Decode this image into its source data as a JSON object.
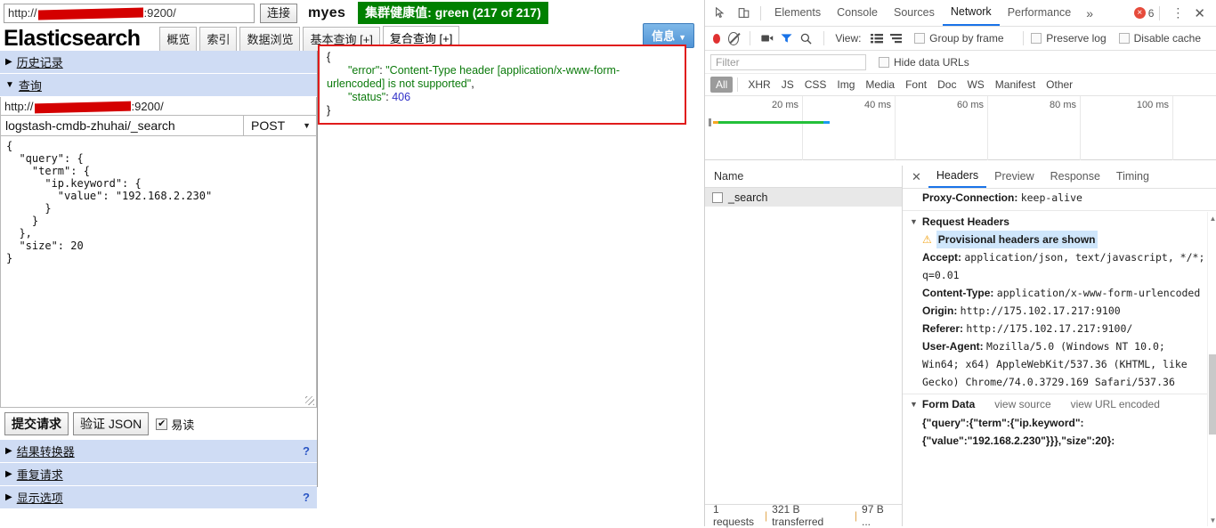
{
  "app": {
    "connect_url_prefix": "http://",
    "connect_url_suffix": ":9200/",
    "connect_button": "连接",
    "cluster_name": "myes",
    "health_badge": "集群健康值: green (217 of 217)",
    "brand": "Elasticsearch",
    "tabs": [
      {
        "label": "概览",
        "active": false
      },
      {
        "label": "索引",
        "active": false
      },
      {
        "label": "数据浏览",
        "active": false
      },
      {
        "label": "基本查询 [+]",
        "active": false
      },
      {
        "label": "复合查询 [+]",
        "active": true
      }
    ],
    "info_button": "信息",
    "sections": {
      "history": "历史记录",
      "query": "查询",
      "result_transformer": "结果转换器",
      "repeat_request": "重复请求",
      "display_options": "显示选项",
      "help_mark": "?"
    },
    "query_form": {
      "url_prefix": "http://",
      "url_suffix": ":9200/",
      "path": "logstash-cmdb-zhuhai/_search",
      "method": "POST",
      "body": "{\n  \"query\": {\n    \"term\": {\n      \"ip.keyword\": {\n        \"value\": \"192.168.2.230\"\n      }\n    }\n  },\n  \"size\": 20\n}",
      "submit_button": "提交请求",
      "validate_button": "验证 JSON",
      "pretty_label": "易读",
      "pretty_checked": true
    },
    "result": {
      "open_brace": "{",
      "error_key": "\"error\"",
      "error_value": "\"Content-Type header [application/x-www-form-urlencoded] is not supported\"",
      "status_key": "\"status\"",
      "status_value": "406",
      "close_brace": "}",
      "border_color": "#e01b1b"
    }
  },
  "devtools": {
    "tabs": [
      {
        "label": "Elements",
        "active": false
      },
      {
        "label": "Console",
        "active": false
      },
      {
        "label": "Sources",
        "active": false
      },
      {
        "label": "Network",
        "active": true
      },
      {
        "label": "Performance",
        "active": false
      }
    ],
    "more_tabs": "»",
    "error_count": "6",
    "toolbar": {
      "view_label": "View:",
      "group_by_frame": "Group by frame",
      "preserve_log": "Preserve log",
      "disable_cache": "Disable cache"
    },
    "filter": {
      "placeholder": "Filter",
      "hide_data_urls": "Hide data URLs",
      "types": [
        "All",
        "XHR",
        "JS",
        "CSS",
        "Img",
        "Media",
        "Font",
        "Doc",
        "WS",
        "Manifest",
        "Other"
      ],
      "active_type": "All"
    },
    "timeline": {
      "ticks": [
        "20 ms",
        "40 ms",
        "60 ms",
        "80 ms",
        "100 ms"
      ],
      "bar_colors": {
        "stalled": "#f5a623",
        "green": "#24c03a",
        "blue": "#1a9bf0"
      }
    },
    "network": {
      "column_name": "Name",
      "rows": [
        {
          "name": "_search"
        }
      ],
      "footer": {
        "requests": "1 requests",
        "transferred": "321 B transferred",
        "resources": "97 B ..."
      }
    },
    "detail": {
      "tabs": [
        {
          "label": "Headers",
          "active": true
        },
        {
          "label": "Preview",
          "active": false
        },
        {
          "label": "Response",
          "active": false
        },
        {
          "label": "Timing",
          "active": false
        }
      ],
      "proxy_connection_name": "Proxy-Connection:",
      "proxy_connection_value": "keep-alive",
      "request_headers_title": "Request Headers",
      "provisional_warning": "Provisional headers are shown",
      "headers": [
        {
          "name": "Accept:",
          "value": "application/json, text/javascript, */*; q=0.01"
        },
        {
          "name": "Content-Type:",
          "value": "application/x-www-form-urlencoded"
        },
        {
          "name": "Origin:",
          "value": "http://175.102.17.217:9100"
        },
        {
          "name": "Referer:",
          "value": "http://175.102.17.217:9100/"
        },
        {
          "name": "User-Agent:",
          "value": "Mozilla/5.0 (Windows NT 10.0; Win64; x64) AppleWebKit/537.36 (KHTML, like Gecko) Chrome/74.0.3729.169 Safari/537.36"
        }
      ],
      "form_data_title": "Form Data",
      "view_source": "view source",
      "view_url_encoded": "view URL encoded",
      "form_data_value": "{\"query\":{\"term\":{\"ip.keyword\":{\"value\":\"192.168.2.230\"}}},\"size\":20}:"
    }
  }
}
